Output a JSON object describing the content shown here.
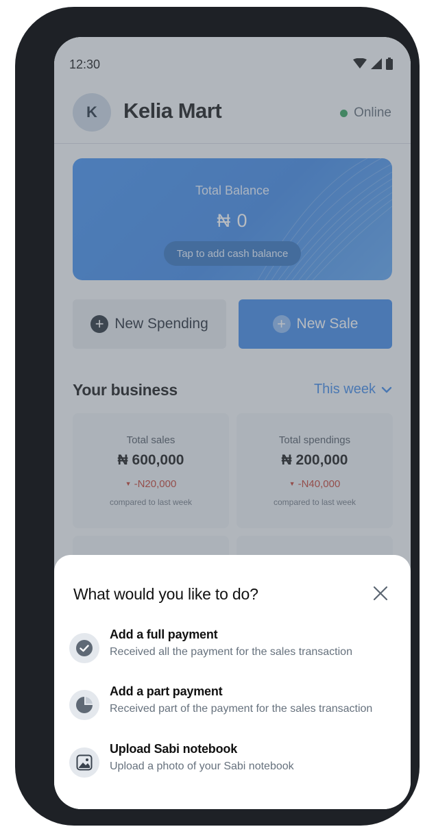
{
  "status_bar": {
    "time": "12:30"
  },
  "header": {
    "avatar_initial": "K",
    "shop_name": "Kelia Mart",
    "status": "Online"
  },
  "balance": {
    "label": "Total Balance",
    "value": "₦ 0",
    "action": "Tap to add cash balance"
  },
  "actions": {
    "new_spending": "New Spending",
    "new_sale": "New Sale"
  },
  "business": {
    "title": "Your business",
    "period": "This week",
    "stats": [
      {
        "title": "Total sales",
        "value": "₦ 600,000",
        "change": "-N20,000",
        "note": "compared to last week"
      },
      {
        "title": "Total spendings",
        "value": "₦ 200,000",
        "change": "-N40,000",
        "note": "compared to last week"
      }
    ]
  },
  "sheet": {
    "title": "What would you like to do?",
    "options": [
      {
        "title": "Add a full payment",
        "subtitle": "Received all the payment for the sales transaction",
        "icon": "check-circle-icon"
      },
      {
        "title": "Add a part payment",
        "subtitle": "Received part of the payment for the sales transaction",
        "icon": "pie-chart-icon"
      },
      {
        "title": "Upload Sabi notebook",
        "subtitle": "Upload a photo of your Sabi notebook",
        "icon": "image-icon"
      }
    ]
  },
  "colors": {
    "accent": "#3b86e6",
    "online": "#2e9e57",
    "negative": "#c0392b"
  }
}
